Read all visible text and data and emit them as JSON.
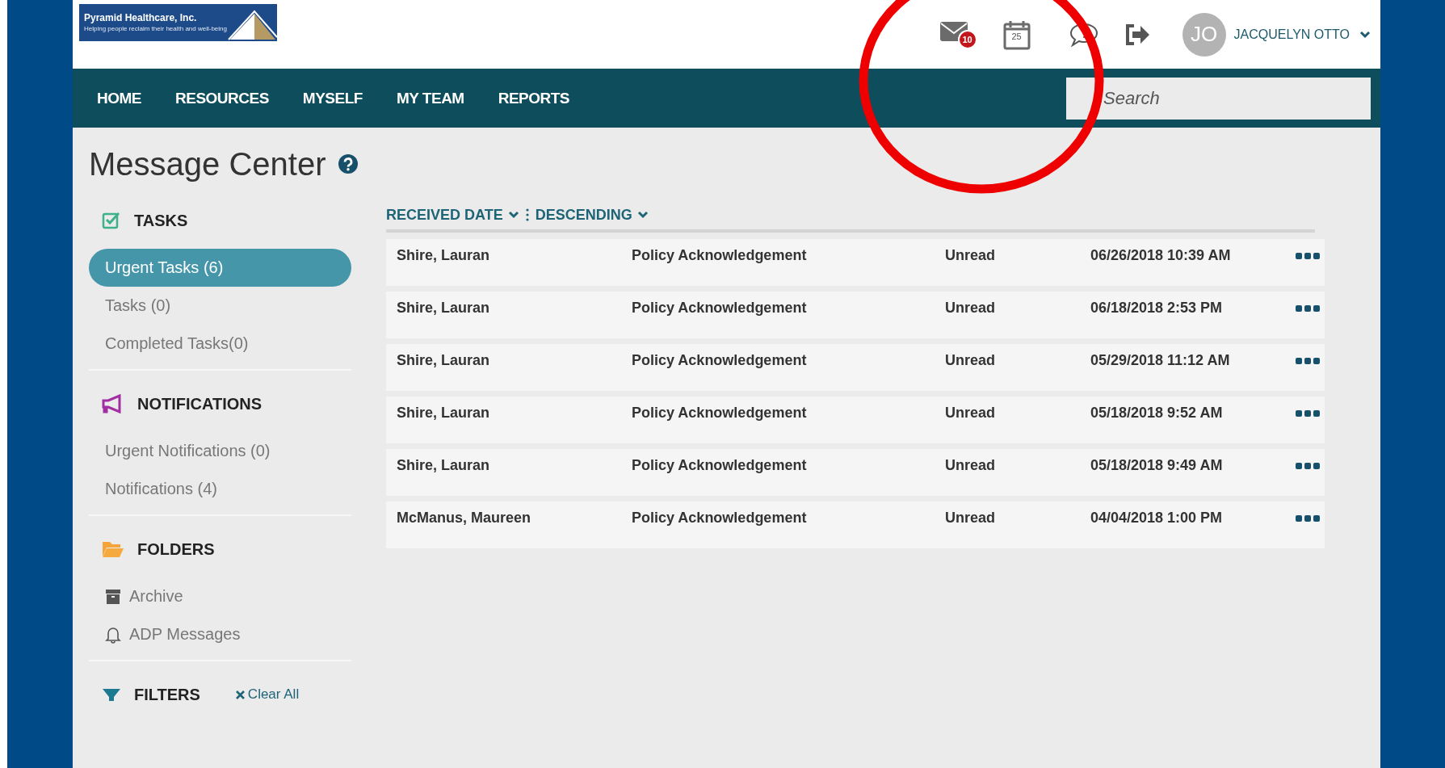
{
  "logo": {
    "name": "Pyramid Healthcare, Inc.",
    "tagline": "Helping people reclaim their health and well-being"
  },
  "header": {
    "mail_badge": "10",
    "calendar_day": "25",
    "user": {
      "initials": "JO",
      "name": "JACQUELYN OTTO"
    }
  },
  "nav": {
    "items": [
      "HOME",
      "RESOURCES",
      "MYSELF",
      "MY TEAM",
      "REPORTS"
    ],
    "search": {
      "placeholder": "Search"
    }
  },
  "page_title": "Message Center",
  "sidebar": [
    {
      "kind": "tasks",
      "title": "TASKS",
      "items": [
        {
          "label": "Urgent Tasks (6)",
          "selected": true
        },
        {
          "label": "Tasks (0)",
          "selected": false
        },
        {
          "label": "Completed Tasks(0)",
          "selected": false
        }
      ]
    },
    {
      "kind": "notifications",
      "title": "NOTIFICATIONS",
      "items": [
        {
          "label": "Urgent Notifications (0)",
          "selected": false
        },
        {
          "label": "Notifications (4)",
          "selected": false
        }
      ]
    },
    {
      "kind": "folders",
      "title": "FOLDERS",
      "items": [
        {
          "label": "Archive",
          "selected": false
        },
        {
          "label": "ADP Messages",
          "selected": false
        }
      ]
    },
    {
      "kind": "filters",
      "title": "FILTERS",
      "action": "Clear All"
    }
  ],
  "sort": {
    "field": "RECEIVED DATE",
    "order": "DESCENDING"
  },
  "messages": [
    {
      "sender": "Shire, Lauran",
      "subject": "Policy Acknowledgement",
      "status": "Unread",
      "received": "06/26/2018 10:39 AM"
    },
    {
      "sender": "Shire, Lauran",
      "subject": "Policy Acknowledgement",
      "status": "Unread",
      "received": "06/18/2018 2:53 PM"
    },
    {
      "sender": "Shire, Lauran",
      "subject": "Policy Acknowledgement",
      "status": "Unread",
      "received": "05/29/2018 11:12 AM"
    },
    {
      "sender": "Shire, Lauran",
      "subject": "Policy Acknowledgement",
      "status": "Unread",
      "received": "05/18/2018 9:52 AM"
    },
    {
      "sender": "Shire, Lauran",
      "subject": "Policy Acknowledgement",
      "status": "Unread",
      "received": "05/18/2018 9:49 AM"
    },
    {
      "sender": "McManus, Maureen",
      "subject": "Policy Acknowledgement",
      "status": "Unread",
      "received": "04/04/2018 1:00 PM"
    }
  ]
}
